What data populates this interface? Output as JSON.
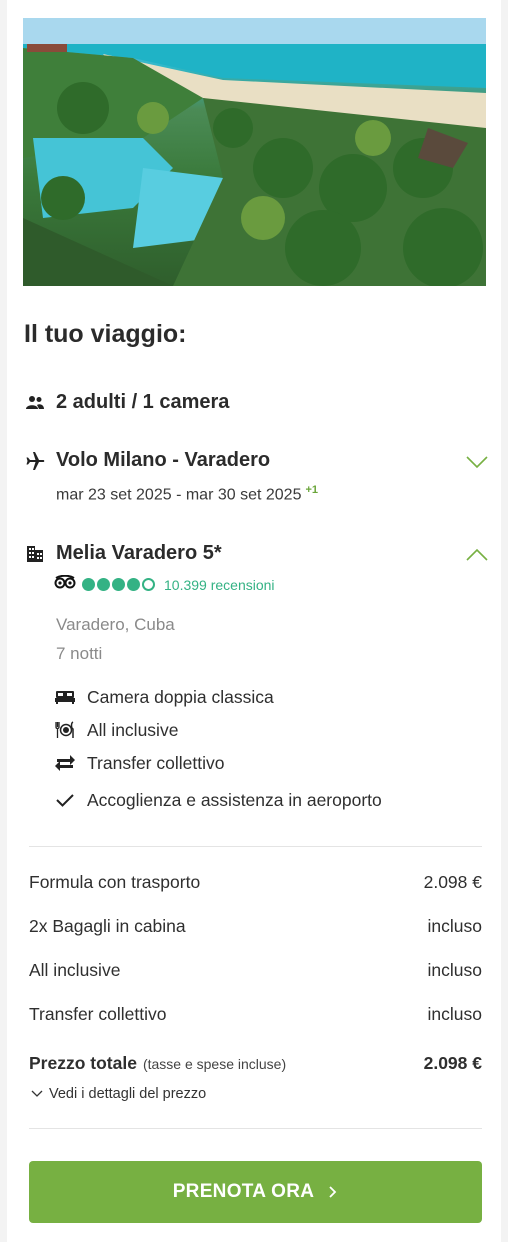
{
  "colors": {
    "accent_green": "#77b042",
    "tripadvisor_green": "#34b284",
    "text": "#2b2b2b",
    "muted": "#8a8a8a"
  },
  "trip": {
    "title": "Il tuo viaggio:",
    "guests": "2 adulti / 1 camera",
    "flight": {
      "title": "Volo Milano - Varadero",
      "dates": "mar 23 set 2025 - mar 30 set 2025",
      "day_offset": "+1"
    },
    "hotel": {
      "name": "Melia Varadero 5*",
      "rating_bubbles": 4,
      "rating_max": 5,
      "reviews": "10.399 recensioni",
      "location": "Varadero, Cuba",
      "nights": "7 notti",
      "features": [
        {
          "icon": "bed-icon",
          "label": "Camera doppia classica"
        },
        {
          "icon": "dining-icon",
          "label": "All inclusive"
        },
        {
          "icon": "transfer-arrows-icon",
          "label": "Transfer collettivo"
        },
        {
          "icon": "check-icon",
          "label": "Accoglienza e assistenza in aeroporto"
        }
      ]
    }
  },
  "pricing": {
    "rows": [
      {
        "label": "Formula con trasporto",
        "value": "2.098 €"
      },
      {
        "label": "2x Bagagli in cabina",
        "value": "incluso"
      },
      {
        "label": "All inclusive",
        "value": "incluso"
      },
      {
        "label": "Transfer collettivo",
        "value": "incluso"
      }
    ],
    "total_label": "Prezzo totale",
    "total_note": "(tasse e spese incluse)",
    "total_value": "2.098 €",
    "details_link": "Vedi i dettagli del prezzo"
  },
  "cta": {
    "label": "PRENOTA ORA"
  }
}
